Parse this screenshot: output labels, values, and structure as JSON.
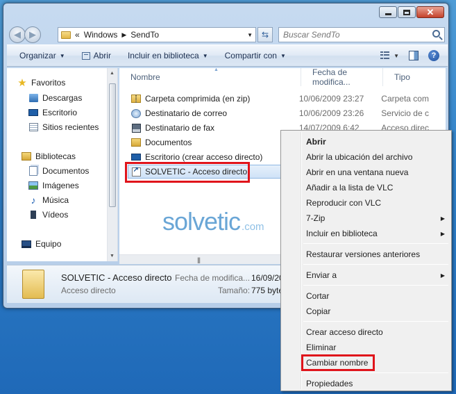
{
  "window": {
    "buttons": {
      "minimize": "minimize",
      "maximize": "maximize",
      "close": "✕"
    }
  },
  "address": {
    "chevrons": "«",
    "crumbs": [
      "Windows",
      "SendTo"
    ],
    "sep": "▶"
  },
  "search": {
    "placeholder": "Buscar SendTo"
  },
  "toolbar": {
    "organize": "Organizar",
    "open": "Abrir",
    "include": "Incluir en biblioteca",
    "share": "Compartir con"
  },
  "nav": {
    "favorites": "Favoritos",
    "downloads": "Descargas",
    "desktop": "Escritorio",
    "recent": "Sitios recientes",
    "libraries": "Bibliotecas",
    "documents": "Documentos",
    "images": "Imágenes",
    "music": "Música",
    "videos": "Vídeos",
    "computer": "Equipo"
  },
  "columns": {
    "name": "Nombre",
    "date": "Fecha de modifica...",
    "type": "Tipo"
  },
  "files": [
    {
      "name": "Carpeta comprimida (en zip)",
      "date": "10/06/2009 23:27",
      "type": "Carpeta com"
    },
    {
      "name": "Destinatario de correo",
      "date": "10/06/2009 23:26",
      "type": "Servicio de c"
    },
    {
      "name": "Destinatario de fax",
      "date": "14/07/2009 6:42",
      "type": "Acceso direc"
    },
    {
      "name": "Documentos",
      "date": "",
      "type": ""
    },
    {
      "name": "Escritorio (crear acceso directo)",
      "date": "",
      "type": ""
    },
    {
      "name": "SOLVETIC - Acceso directo",
      "date": "",
      "type": ""
    }
  ],
  "watermark": {
    "brand": "solvetic",
    "tld": ".com"
  },
  "details": {
    "name": "SOLVETIC - Acceso directo",
    "type": "Acceso directo",
    "date_label": "Fecha de modifica...",
    "date_value": "16/09/20",
    "size_label": "Tamaño:",
    "size_value": "775 byte"
  },
  "context_menu": {
    "open": "Abrir",
    "open_location": "Abrir la ubicación del archivo",
    "open_new_window": "Abrir en una ventana nueva",
    "add_vlc": "Añadir a la lista de VLC",
    "play_vlc": "Reproducir con VLC",
    "sevenzip": "7-Zip",
    "include_library": "Incluir en biblioteca",
    "restore": "Restaurar versiones anteriores",
    "send_to": "Enviar a",
    "cut": "Cortar",
    "copy": "Copiar",
    "create_shortcut": "Crear acceso directo",
    "delete": "Eliminar",
    "rename": "Cambiar nombre",
    "properties": "Propiedades",
    "submenu_arrow": "▶"
  },
  "colors": {
    "highlight_box": "#e0141b",
    "watermark": "#6aa6d6"
  }
}
